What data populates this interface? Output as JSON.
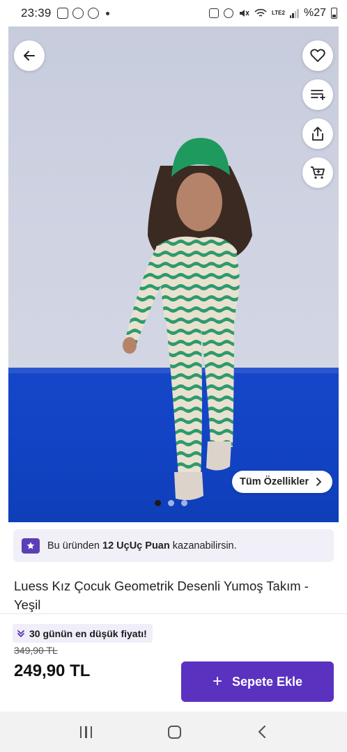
{
  "status_bar": {
    "time": "23:39",
    "battery": "%27",
    "network": "LTE2",
    "icons": [
      "instagram-icon",
      "whatsapp-icon",
      "notification-icon",
      "dot-icon",
      "lock-icon",
      "alarm-icon",
      "mute-icon",
      "wifi-icon",
      "signal-icon",
      "battery-icon"
    ]
  },
  "hero": {
    "tum_ozellikler_label": "Tüm Özellikler",
    "image_dots": 3,
    "active_dot": 0,
    "icons": {
      "back": "arrow-left-icon",
      "favorite": "heart-icon",
      "compare": "list-add-icon",
      "share": "share-icon",
      "cart": "cart-icon",
      "chevron": "chevron-right-icon"
    }
  },
  "points_banner": {
    "prefix": "Bu üründen",
    "points": "12 UçUç Puan",
    "suffix": "kazanabilirsin."
  },
  "product": {
    "title": "Luess Kız Çocuk Geometrik Desenli Yumoş Takım - Yeşil"
  },
  "pricing": {
    "lowest_badge": "30 günün en düşük fiyatı!",
    "old_price": "349,90 TL",
    "price": "249,90 TL",
    "add_to_cart": "Sepete Ekle"
  },
  "colors": {
    "accent": "#5b32bf",
    "banner_bg": "#f1eff8"
  }
}
